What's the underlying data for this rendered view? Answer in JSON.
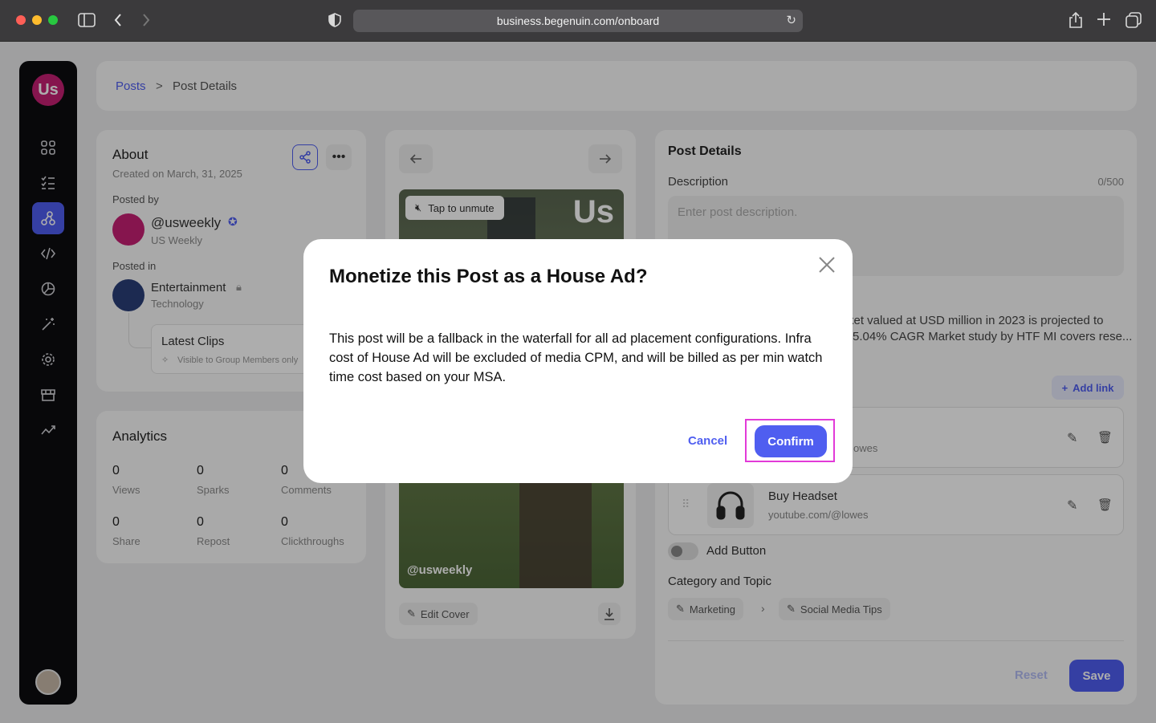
{
  "browser": {
    "url": "business.begenuin.com/onboard"
  },
  "sidebar": {
    "logo_text": "Us",
    "icons": [
      "grid-icon",
      "list-checks-icon",
      "network-icon",
      "code-icon",
      "chart-pie-icon",
      "magic-wand-icon",
      "gear-icon",
      "store-icon",
      "trend-icon"
    ]
  },
  "breadcrumb": {
    "root": "Posts",
    "separator": ">",
    "current": "Post Details"
  },
  "about": {
    "title": "About",
    "created": "Created on March, 31, 2025",
    "posted_by_label": "Posted by",
    "handle": "@usweekly",
    "account_name": "US Weekly",
    "posted_in_label": "Posted in",
    "community": "Entertainment",
    "community_sub": "Technology",
    "group_name": "Latest Clips",
    "group_visibility": "Visible to Group Members only"
  },
  "analytics": {
    "title": "Analytics",
    "stats": [
      {
        "value": "0",
        "label": "Views"
      },
      {
        "value": "0",
        "label": "Sparks"
      },
      {
        "value": "0",
        "label": "Comments"
      },
      {
        "value": "0",
        "label": "Share"
      },
      {
        "value": "0",
        "label": "Repost"
      },
      {
        "value": "0",
        "label": "Clickthroughs"
      }
    ]
  },
  "video": {
    "mute_label": "Tap to unmute",
    "brand_text": "Us",
    "watermark": "@usweekly",
    "edit_cover": "Edit Cover"
  },
  "post_details": {
    "title": "Post Details",
    "description_label": "Description",
    "description_count": "0/500",
    "description_placeholder": "Enter post description.",
    "partial_line1": "ket valued at USD million in 2023 is projected to",
    "partial_line2": "5.04% CAGR Market study by HTF MI covers rese...",
    "add_link": "Add link",
    "link1_url_partial": "owes",
    "link2_title": "Buy Headset",
    "link2_url": "youtube.com/@lowes",
    "add_button_label": "Add Button",
    "category_label": "Category and Topic",
    "category": "Marketing",
    "topic": "Social Media Tips",
    "reset": "Reset",
    "save": "Save"
  },
  "modal": {
    "title": "Monetize this Post as a House Ad?",
    "body": "This post will be a fallback in the waterfall for all ad placement configurations. Infra cost of House Ad will be excluded of media CPM, and will be billed as per min watch time cost based on your MSA.",
    "cancel": "Cancel",
    "confirm": "Confirm"
  },
  "colors": {
    "accent": "#4f5ef0",
    "brand": "#d1247a",
    "highlight": "#e23ad8"
  }
}
